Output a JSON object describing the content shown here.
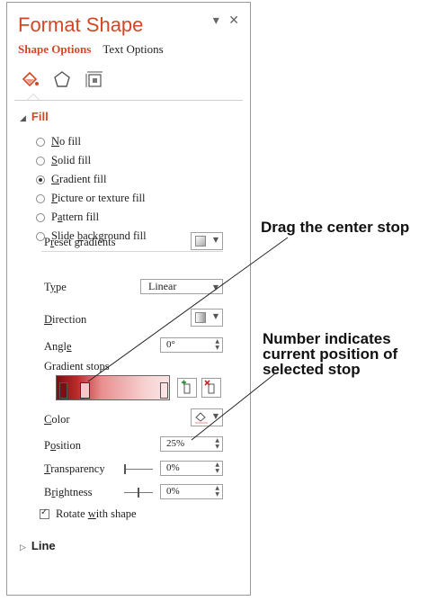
{
  "pane": {
    "title": "Format Shape",
    "dropdown_glyph": "▾",
    "close_glyph": "✕"
  },
  "tabs": [
    {
      "label": "Shape Options",
      "active": true
    },
    {
      "label": "Text Options",
      "active": false
    }
  ],
  "icons": [
    "fill-line-icon",
    "effects-pentagon-icon",
    "size-properties-icon"
  ],
  "fill": {
    "header": "Fill",
    "options": [
      {
        "pre": "",
        "key": "N",
        "post": "o fill",
        "selected": false
      },
      {
        "pre": "",
        "key": "S",
        "post": "olid fill",
        "selected": false
      },
      {
        "pre": "",
        "key": "G",
        "post": "radient fill",
        "selected": true
      },
      {
        "pre": "",
        "key": "P",
        "post": "icture or texture fill",
        "selected": false
      },
      {
        "pre": "P",
        "key": "a",
        "post": "ttern fill",
        "selected": false
      },
      {
        "pre": "Slide ",
        "key": "b",
        "post": "ackground fill",
        "selected": false
      }
    ],
    "preset_gradients": {
      "pre": "P",
      "key": "r",
      "post": "eset gradients"
    },
    "type": {
      "pre": "T",
      "key": "y",
      "post": "pe",
      "value": "Linear"
    },
    "direction": {
      "pre": "",
      "key": "D",
      "post": "irection"
    },
    "angle": {
      "pre": "Angl",
      "key": "e",
      "post": "",
      "value": "0°"
    },
    "gradient_stops_label": "Gradient stops",
    "color": {
      "pre": "",
      "key": "C",
      "post": "olor"
    },
    "position": {
      "pre": "P",
      "key": "o",
      "post": "sition",
      "value": "25%"
    },
    "transparency": {
      "pre": "",
      "key": "T",
      "post": "ransparency",
      "value": "0%",
      "level": 0.0
    },
    "brightness": {
      "pre": "B",
      "key": "r",
      "post": "ightness",
      "value": "0%",
      "level": 0.5
    },
    "rotate": {
      "pre": "Rotate ",
      "key": "w",
      "post": "ith shape",
      "checked": true
    }
  },
  "line": {
    "header": "Line"
  },
  "callouts": {
    "drag": "Drag the center stop",
    "number": [
      "Number indicates",
      "current position of",
      "selected stop"
    ]
  },
  "colors": {
    "accent": "#d24726",
    "gradient_dark": "#7a1010",
    "gradient_light": "#fbe3e3"
  }
}
